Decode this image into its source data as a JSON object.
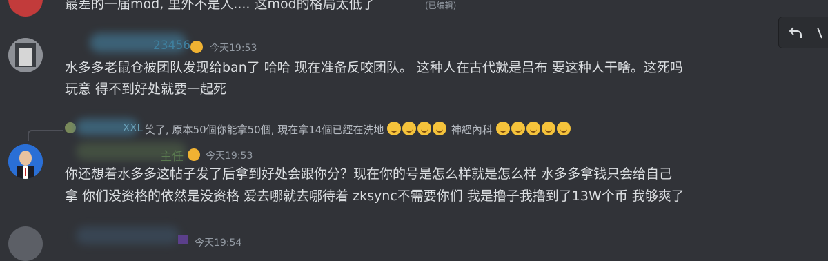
{
  "messages": [
    {
      "text": "最差的一届mod, 里外不是人....  这mod的格局太低了",
      "edited_label": "(已编辑)"
    },
    {
      "username": "23456",
      "timestamp": "今天19:53",
      "lines": [
        "水多多老鼠仓被团队发现给ban了 哈哈 现在准备反咬团队。 这种人在古代就是吕布 要这种人干啥。这死吗",
        "玩意 得不到好处就要一起死"
      ]
    },
    {
      "reply": {
        "username": "XXL",
        "text": "笑了, 原本50個你能拿50個, 現在拿14個已經在洗地",
        "text_after": "神經內科"
      },
      "username": "主任",
      "timestamp": "今天19:53",
      "lines": [
        "你还想着水多多这帖子发了后拿到好处会跟你分？现在你的号是怎么样就是怎么样 水多多拿钱只会给自己",
        "拿 你们没资格的依然是没资格 爱去哪就去哪待着 zksync不需要你们 我是撸子我撸到了13W个币 我够爽了"
      ]
    },
    {
      "timestamp": "今天19:54"
    }
  ],
  "toolbar": {
    "reply_icon": "reply-arrow-icon",
    "more_icon": "more-options-icon"
  }
}
